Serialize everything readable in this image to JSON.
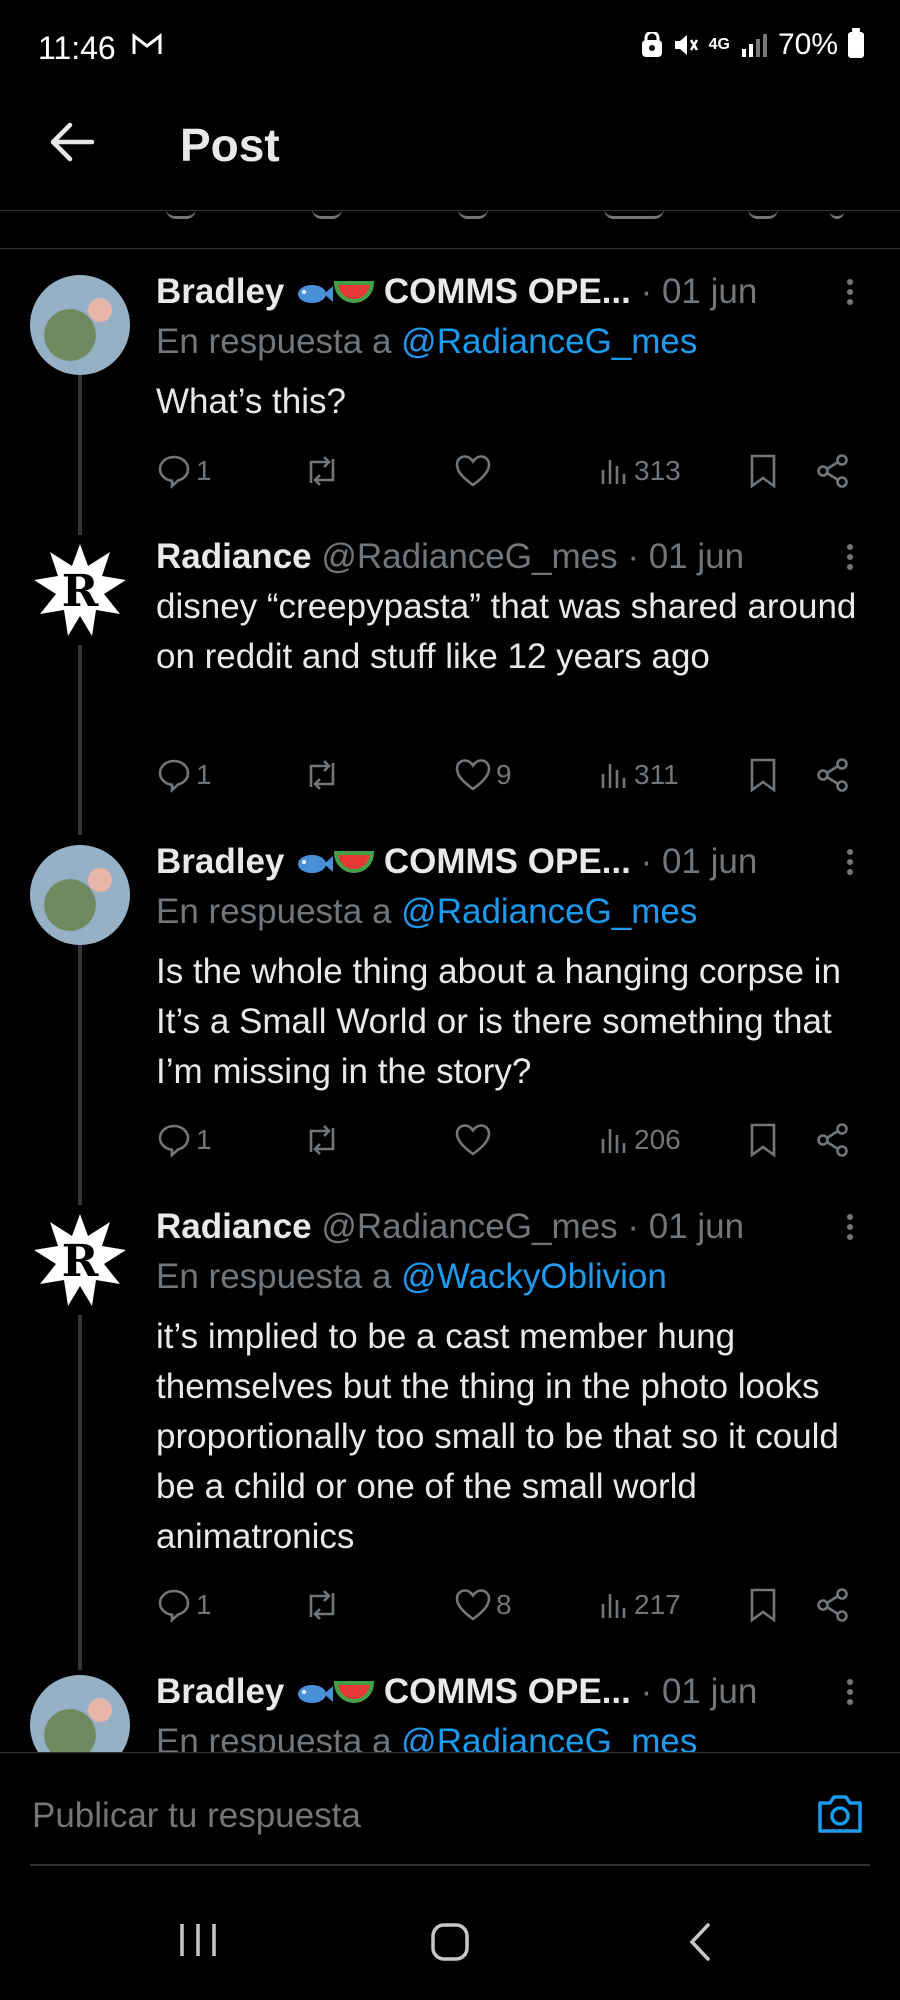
{
  "status_bar": {
    "time": "11:46",
    "network": "4G",
    "battery": "70%"
  },
  "header": {
    "title": "Post"
  },
  "tweets": [
    {
      "author": "Bradley",
      "author_suffix": "COMMS OPE...",
      "date": "· 01 jun",
      "reply_prefix": "En respuesta a",
      "reply_to": "@RadianceG_mes",
      "text": "What’s this?",
      "replies": "1",
      "likes": "",
      "views": "313"
    },
    {
      "author": "Radiance",
      "handle": "@RadianceG_mes",
      "date": "· 01 jun",
      "text": "disney “creepypasta” that was shared around on reddit and stuff like 12 years ago",
      "replies": "1",
      "likes": "9",
      "views": "311"
    },
    {
      "author": "Bradley",
      "author_suffix": "COMMS OPE...",
      "date": "· 01 jun",
      "reply_prefix": "En respuesta a",
      "reply_to": "@RadianceG_mes",
      "text": "Is the whole thing about a hanging corpse in It’s a Small World or is there something that I’m missing in the story?",
      "replies": "1",
      "likes": "",
      "views": "206"
    },
    {
      "author": "Radiance",
      "handle": "@RadianceG_mes",
      "date": "· 01 jun",
      "reply_prefix": "En respuesta a",
      "reply_to": "@WackyOblivion",
      "text": "it’s implied to be a cast member hung themselves but the thing in the photo looks proportionally too small to be that so it could be a child or one of the small world animatronics",
      "replies": "1",
      "likes": "8",
      "views": "217"
    },
    {
      "author": "Bradley",
      "author_suffix": "COMMS OPE...",
      "date": "· 01 jun",
      "reply_prefix": "En respuesta a",
      "reply_to": "@RadianceG_mes"
    }
  ],
  "compose": {
    "placeholder": "Publicar tu respuesta"
  },
  "colors": {
    "background": "#000000",
    "text": "#e7e9ea",
    "muted": "#71767b",
    "accent": "#1d9bf0",
    "divider": "#2f3336"
  },
  "icons": [
    "back-arrow-icon",
    "reply-icon",
    "retweet-icon",
    "like-icon",
    "views-icon",
    "bookmark-icon",
    "share-icon",
    "more-icon",
    "camera-icon",
    "recents-icon",
    "home-icon",
    "back-nav-icon"
  ]
}
